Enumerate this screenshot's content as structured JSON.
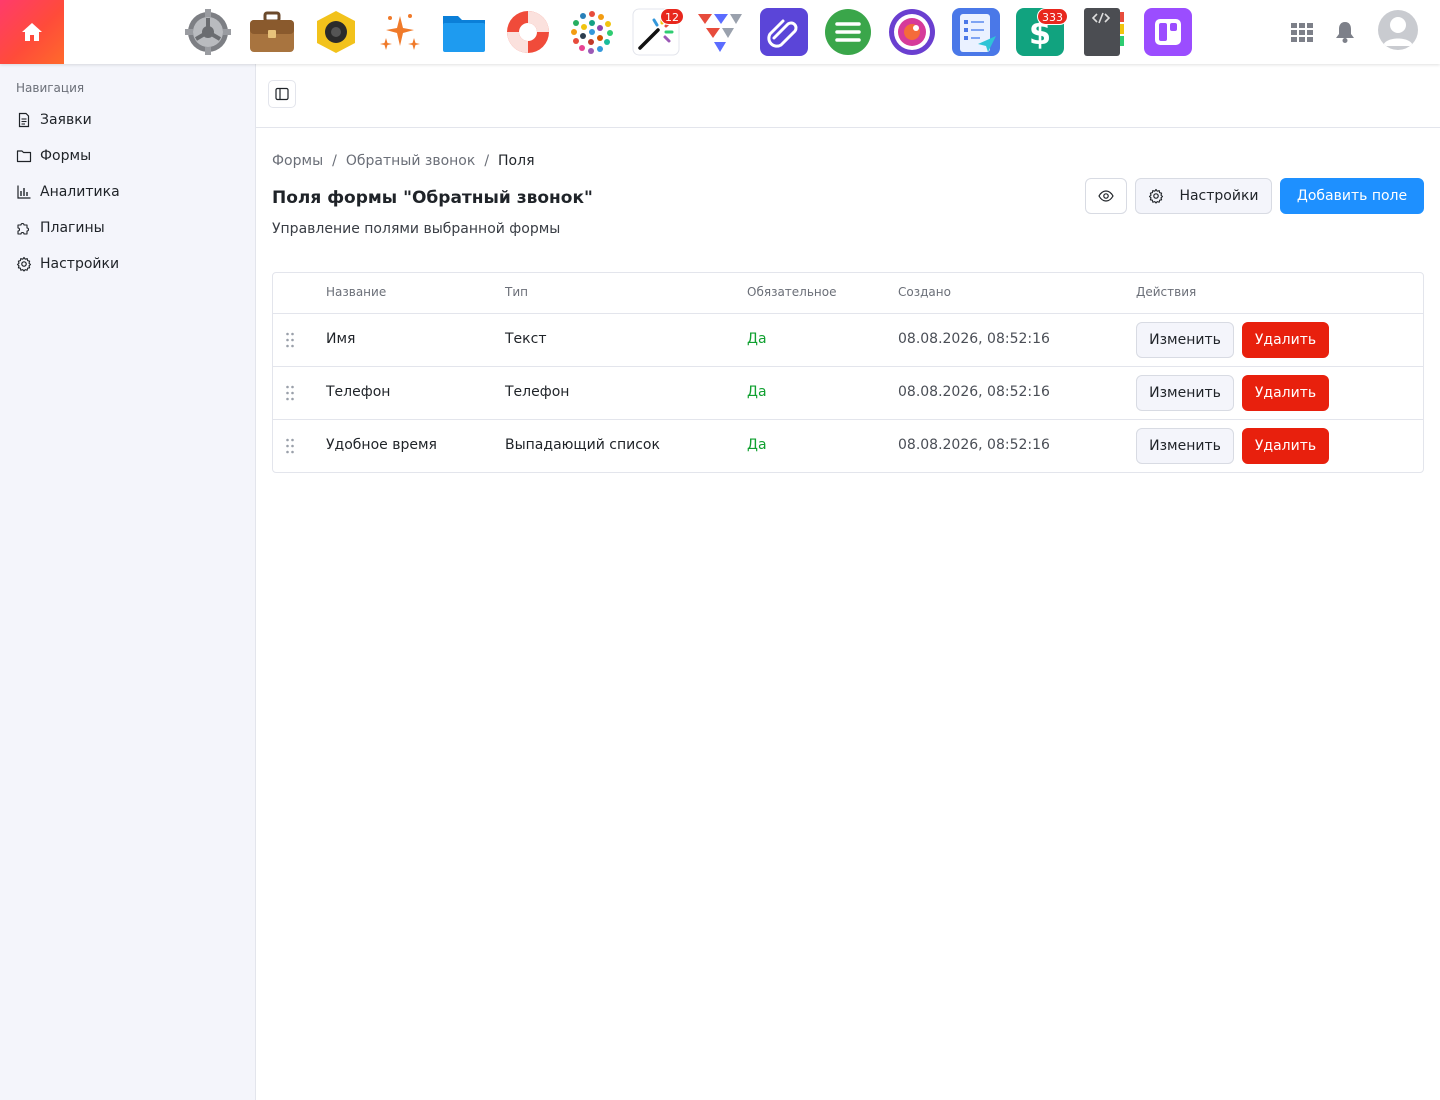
{
  "topbar": {
    "apps": [
      {
        "icon": "gear-app-icon"
      },
      {
        "icon": "briefcase-app-icon"
      },
      {
        "icon": "camera-hexagon-app-icon"
      },
      {
        "icon": "sparkles-app-icon"
      },
      {
        "icon": "folder-app-icon"
      },
      {
        "icon": "lifebuoy-app-icon"
      },
      {
        "icon": "color-dots-app-icon"
      },
      {
        "icon": "magic-wand-app-icon",
        "badge": "12"
      },
      {
        "icon": "paper-planes-app-icon"
      },
      {
        "icon": "paperclip-app-icon"
      },
      {
        "icon": "menu-lines-app-icon"
      },
      {
        "icon": "circle-lens-app-icon"
      },
      {
        "icon": "checklist-app-icon"
      },
      {
        "icon": "dollar-app-icon",
        "badge": "333"
      },
      {
        "icon": "code-notebook-app-icon"
      },
      {
        "icon": "dashboard-app-icon"
      }
    ],
    "colors": {
      "home_gradient_start": "#ff3b6b",
      "home_gradient_end": "#ff6a2b"
    }
  },
  "sidebar": {
    "title": "Навигация",
    "items": [
      {
        "label": "Заявки",
        "icon": "document-icon"
      },
      {
        "label": "Формы",
        "icon": "folder-icon"
      },
      {
        "label": "Аналитика",
        "icon": "bar-chart-icon"
      },
      {
        "label": "Плагины",
        "icon": "puzzle-icon"
      },
      {
        "label": "Настройки",
        "icon": "gear-icon"
      }
    ]
  },
  "breadcrumb": {
    "items": [
      "Формы",
      "Обратный звонок",
      "Поля"
    ],
    "separator": "/"
  },
  "page": {
    "title": "Поля формы \"Обратный звонок\"",
    "subtitle": "Управление полями выбранной формы"
  },
  "actions": {
    "settings_label": "Настройки",
    "add_field_label": "Добавить поле",
    "primary_color": "#1e90ff",
    "danger_color": "#e8200d"
  },
  "table": {
    "headers": [
      "Название",
      "Тип",
      "Обязательное",
      "Создано",
      "Действия"
    ],
    "rows": [
      {
        "name": "Имя",
        "type": "Текст",
        "required": "Да",
        "created": "08.08.2026, 08:52:16",
        "edit": "Изменить",
        "delete": "Удалить"
      },
      {
        "name": "Телефон",
        "type": "Телефон",
        "required": "Да",
        "created": "08.08.2026, 08:52:16",
        "edit": "Изменить",
        "delete": "Удалить"
      },
      {
        "name": "Удобное время",
        "type": "Выпадающий список",
        "required": "Да",
        "created": "08.08.2026, 08:52:16",
        "edit": "Изменить",
        "delete": "Удалить"
      }
    ]
  }
}
